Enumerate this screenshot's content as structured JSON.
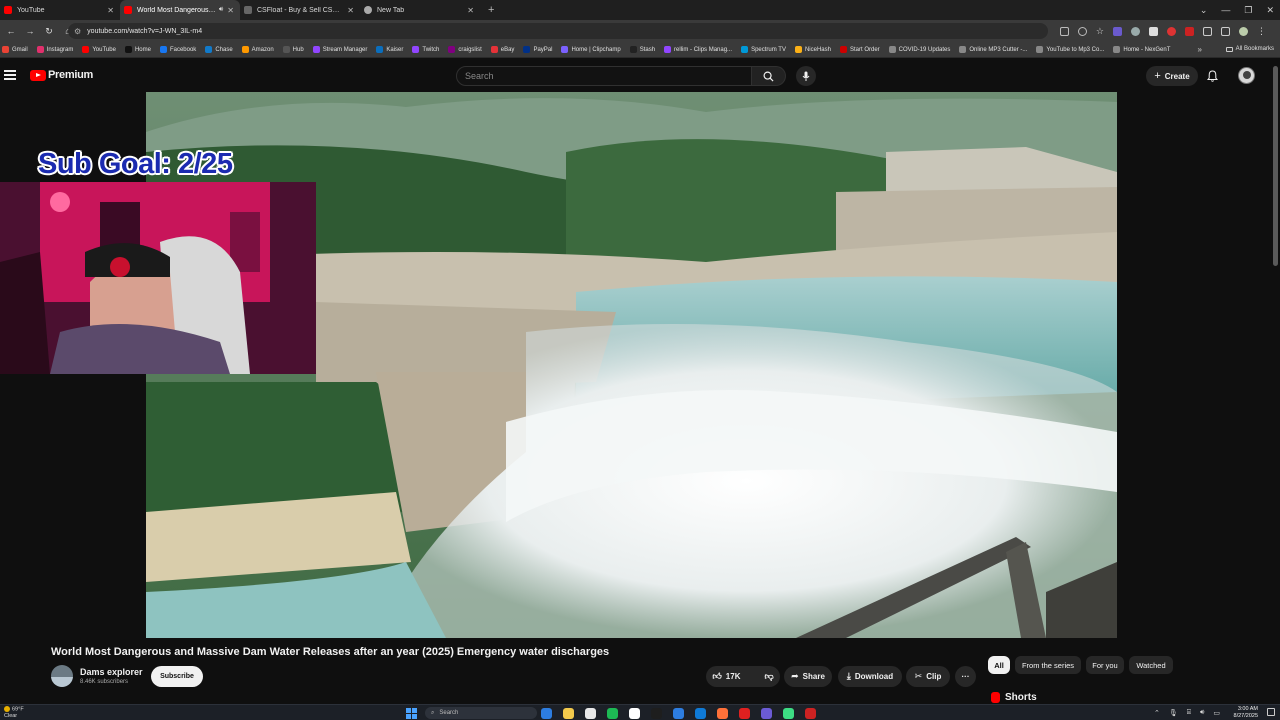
{
  "browser": {
    "tabs": [
      {
        "title": "YouTube",
        "favicon_color": "#ff0000",
        "active": false,
        "audio": false
      },
      {
        "title": "World Most Dangerous and",
        "favicon_color": "#ff0000",
        "active": true,
        "audio": true
      },
      {
        "title": "CSFloat - Buy & Sell CS2 Skins",
        "favicon_color": "#666666",
        "active": false,
        "audio": false
      },
      {
        "title": "New Tab",
        "favicon_color": "#aaaaaa",
        "active": false,
        "audio": false
      }
    ],
    "address": "youtube.com/watch?v=J-WN_3IL-m4",
    "bookmarks": [
      {
        "label": "Gmail",
        "color": "#ea4335"
      },
      {
        "label": "Instagram",
        "color": "#e1306c"
      },
      {
        "label": "YouTube",
        "color": "#ff0000"
      },
      {
        "label": "Home",
        "color": "#111111"
      },
      {
        "label": "Facebook",
        "color": "#1877f2"
      },
      {
        "label": "Chase",
        "color": "#117aca"
      },
      {
        "label": "Amazon",
        "color": "#ff9900"
      },
      {
        "label": "Hub",
        "color": "#555555"
      },
      {
        "label": "Stream Manager",
        "color": "#9146ff"
      },
      {
        "label": "Kaiser",
        "color": "#0a6ebd"
      },
      {
        "label": "Twitch",
        "color": "#9146ff"
      },
      {
        "label": "craigslist",
        "color": "#800080"
      },
      {
        "label": "eBay",
        "color": "#e53238"
      },
      {
        "label": "PayPal",
        "color": "#003087"
      },
      {
        "label": "Home | Clipchamp",
        "color": "#7b61ff"
      },
      {
        "label": "Stash",
        "color": "#222222"
      },
      {
        "label": "rellim - Clips Manag...",
        "color": "#9146ff"
      },
      {
        "label": "Spectrum TV",
        "color": "#0099d8"
      },
      {
        "label": "NiceHash",
        "color": "#fbb017"
      },
      {
        "label": "Start Order",
        "color": "#cc0000"
      },
      {
        "label": "COVID-19 Updates",
        "color": "#888888"
      },
      {
        "label": "Online MP3 Cutter -...",
        "color": "#888888"
      },
      {
        "label": "YouTube to Mp3 Co...",
        "color": "#888888"
      },
      {
        "label": "Home - NexGenT",
        "color": "#888888"
      }
    ],
    "all_bookmarks": "All Bookmarks"
  },
  "youtube": {
    "logo": "Premium",
    "search_placeholder": "Search",
    "create_label": "Create",
    "video": {
      "title": "World Most Dangerous and Massive Dam Water Releases after an year (2025) Emergency water discharges",
      "channel": "Dams explorer",
      "subscribers": "8.46K subscribers",
      "subscribe_label": "Subscribe",
      "likes": "17K",
      "share_label": "Share",
      "download_label": "Download",
      "clip_label": "Clip"
    },
    "overlay_text": "Sub Goal: 2/25",
    "chips": [
      "All",
      "From the series",
      "For you",
      "Watched"
    ],
    "shorts_label": "Shorts"
  },
  "taskbar": {
    "weather_temp": "69°F",
    "weather_desc": "Clear",
    "search_placeholder": "Search",
    "time": "3:00 AM",
    "date": "8/27/2025",
    "apps": [
      "#2d7de0",
      "#f2c94c",
      "#e8e8e8",
      "#1db954",
      "#ffffff",
      "#1e1e1e",
      "#2d7de0",
      "#0f7ad6",
      "#ff7139",
      "#e02020",
      "#6b5bd6",
      "#3ddc84",
      "#cc2222"
    ]
  },
  "colors": {
    "accent": "#ff0000",
    "background": "#0f0f0f",
    "overlay_text": "#1b2bb0"
  }
}
